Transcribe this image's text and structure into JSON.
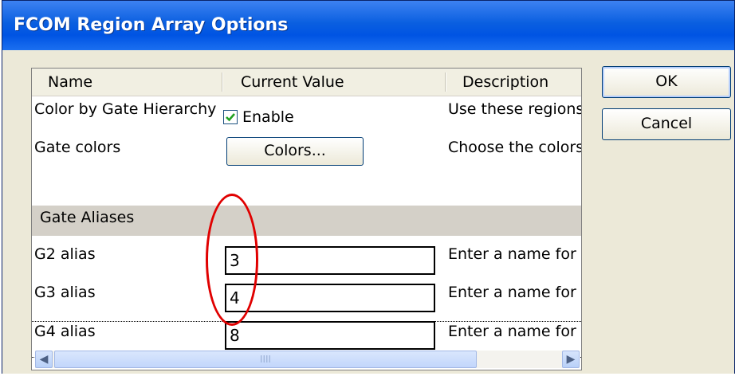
{
  "window": {
    "title": "FCOM Region Array Options"
  },
  "grid": {
    "headers": [
      "Name",
      "Current Value",
      "Description"
    ],
    "rows": [
      {
        "name": "Color by Gate Hierarchy",
        "value_label": "Enable",
        "checked": true,
        "description": "Use these regions"
      },
      {
        "name": "Gate colors",
        "value_button": "Colors...",
        "description": "Choose the colors"
      }
    ],
    "group_label": "Gate Aliases",
    "alias_rows": [
      {
        "name": "G2 alias",
        "value": "3",
        "description": "Enter a name for g"
      },
      {
        "name": "G3 alias",
        "value": "4",
        "description": "Enter a name for g"
      },
      {
        "name": "G4 alias",
        "value": "8",
        "description": "Enter a name for g"
      }
    ],
    "scrollbar_grip": "IIII"
  },
  "buttons": {
    "ok": "OK",
    "cancel": "Cancel"
  },
  "colors": {
    "title_bar": "#0054e3",
    "annotation": "#e00000"
  }
}
